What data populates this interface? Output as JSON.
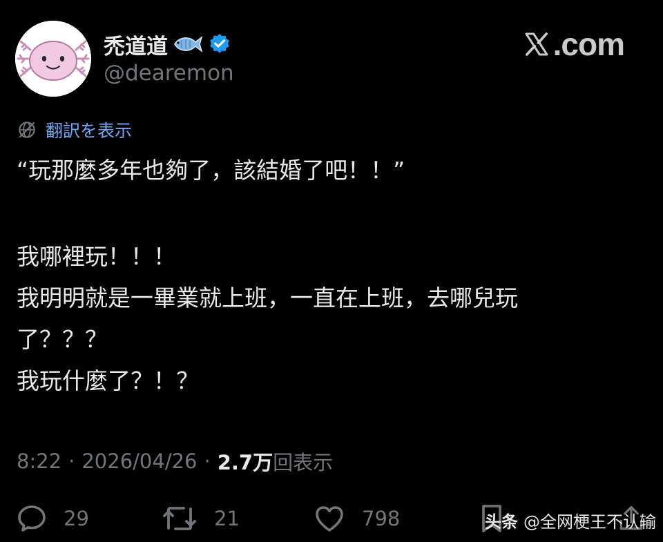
{
  "author": {
    "display_name": "禿道道",
    "handle": "@dearemon",
    "avatar_icon": "axolotl-avatar-icon",
    "verified": true
  },
  "brand": {
    "logo_icon": "x-logo-icon",
    "text": ".com"
  },
  "translate": {
    "label": "翻訳を表示"
  },
  "tweet": {
    "lines": [
      "“玩那麼多年也夠了，該結婚了吧！！”",
      "我哪裡玩！！！",
      "我明明就是一畢業就上班，一直在上班，去哪兒玩",
      "了？？？",
      "我玩什麼了？！？"
    ]
  },
  "meta": {
    "time": "8:22",
    "separator": "·",
    "date": "2026/04/26",
    "views_count": "2.7万",
    "views_label": "回表示"
  },
  "actions": {
    "reply_count": "29",
    "retweet_count": "21",
    "like_count": "798"
  },
  "watermark": {
    "brand": "头条",
    "text": "@全网梗王不认输"
  },
  "colors": {
    "background": "#000000",
    "text": "#e7e9ea",
    "muted": "#71767b",
    "link": "#6ea8f7",
    "verified": "#1d9bf0"
  }
}
